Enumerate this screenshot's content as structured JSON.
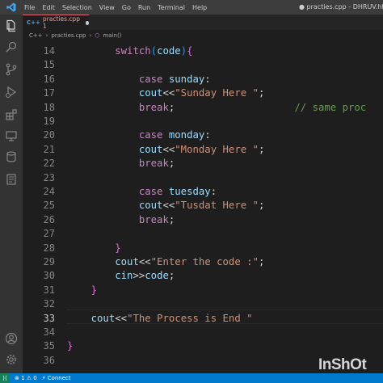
{
  "titlebar": {
    "menu": [
      "File",
      "Edit",
      "Selection",
      "View",
      "Go",
      "Run",
      "Terminal",
      "Help"
    ],
    "window_title": "● practies.cpp - DHRUV.html - Vi"
  },
  "tabs": [
    {
      "prefix": "C++",
      "label": "practies.cpp 1"
    }
  ],
  "breadcrumb": {
    "language": "C++",
    "file": "practies.cpp",
    "symbol": "main()"
  },
  "editor": {
    "lines": [
      {
        "number": "14",
        "code": "        switch(code){"
      },
      {
        "number": "15",
        "code": ""
      },
      {
        "number": "16",
        "code": "            case sunday:"
      },
      {
        "number": "17",
        "code": "            cout<<\"Sunday Here \";"
      },
      {
        "number": "18",
        "code": "            break;                    // same proc"
      },
      {
        "number": "19",
        "code": ""
      },
      {
        "number": "20",
        "code": "            case monday:"
      },
      {
        "number": "21",
        "code": "            cout<<\"Monday Here \";"
      },
      {
        "number": "22",
        "code": "            break;"
      },
      {
        "number": "23",
        "code": ""
      },
      {
        "number": "24",
        "code": "            case tuesday:"
      },
      {
        "number": "25",
        "code": "            cout<<\"Tusdat Here \";"
      },
      {
        "number": "26",
        "code": "            break;"
      },
      {
        "number": "27",
        "code": ""
      },
      {
        "number": "28",
        "code": "        }"
      },
      {
        "number": "29",
        "code": "        cout<<\"Enter the code :\";"
      },
      {
        "number": "30",
        "code": "        cin>>code;"
      },
      {
        "number": "31",
        "code": "    }"
      },
      {
        "number": "32",
        "code": ""
      },
      {
        "number": "33",
        "code": "    cout<<\"The Process is End \""
      },
      {
        "number": "34",
        "code": ""
      },
      {
        "number": "35",
        "code": "}"
      },
      {
        "number": "36",
        "code": ""
      }
    ],
    "current_line": "33"
  },
  "statusbar": {
    "problems": "⊗ 1 ⚠ 0",
    "connect": "Connect"
  },
  "watermark": "InShOt",
  "colors": {
    "accent": "#007acc",
    "keyword": "#c586c0",
    "identifier": "#9cdcfe",
    "string": "#ce9178",
    "comment": "#6a9955"
  }
}
